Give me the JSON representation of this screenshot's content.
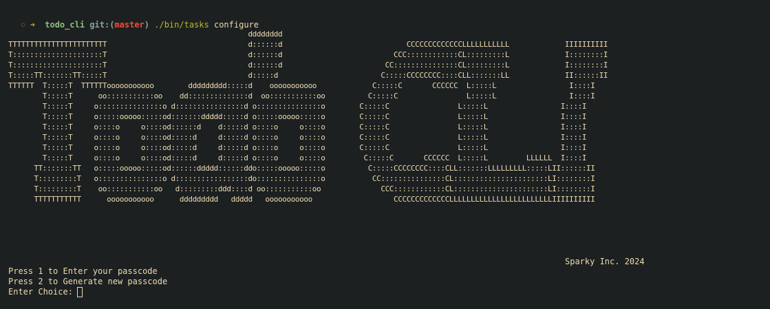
{
  "prompt": {
    "indicator": "○",
    "arrow": "➜",
    "directory": "todo_cli",
    "git_label": "git:",
    "paren_open": "(",
    "branch": "master",
    "paren_close": ")",
    "command_path": "./bin/tasks",
    "command_arg": "configure"
  },
  "banner": {
    "art_lines": [
      "                                                        dddddddd",
      "TTTTTTTTTTTTTTTTTTTTTTT                                 d::::::d                             CCCCCCCCCCCCCLLLLLLLLLLL             IIIIIIIIII",
      "T:::::::::::::::::::::T                                 d::::::d                          CCC::::::::::::CL:::::::::L             I::::::::I",
      "T:::::::::::::::::::::T                                 d::::::d                        CC:::::::::::::::CL:::::::::L             I::::::::I",
      "T:::::TT:::::::TT:::::T                                 d:::::d                        C:::::CCCCCCCC::::CLL:::::::LL             II::::::II",
      "TTTTTT  T:::::T  TTTTTTooooooooooo        ddddddddd:::::d    ooooooooooo             C:::::C       CCCCCC  L:::::L                 I::::I",
      "        T:::::T      oo:::::::::::oo    dd::::::::::::::d  oo:::::::::::oo          C:::::C                L:::::L                 I::::I",
      "        T:::::T     o:::::::::::::::o d::::::::::::::::d o:::::::::::::::o        C:::::C                L:::::L                 I::::I",
      "        T:::::T     o:::::ooooo:::::od:::::::ddddd:::::d o:::::ooooo:::::o        C:::::C                L:::::L                 I::::I",
      "        T:::::T     o::::o     o::::od::::::d    d:::::d o::::o     o::::o        C:::::C                L:::::L                 I::::I",
      "        T:::::T     o::::o     o::::od:::::d     d:::::d o::::o     o::::o        C:::::C                L:::::L                 I::::I",
      "        T:::::T     o::::o     o::::od:::::d     d:::::d o::::o     o::::o        C:::::C                L:::::L                 I::::I",
      "        T:::::T     o::::o     o::::od:::::d     d:::::d o::::o     o::::o         C:::::C       CCCCCC  L:::::L         LLLLLL  I::::I",
      "      TT:::::::TT   o:::::ooooo:::::od::::::ddddd::::::ddo:::::ooooo:::::o          C:::::CCCCCCCC::::CLL:::::::LLLLLLLLL:::::LII::::::II",
      "      T:::::::::T   o:::::::::::::::o d:::::::::::::::::do:::::::::::::::o           CC:::::::::::::::CL::::::::::::::::::::::LI::::::::I",
      "      T:::::::::T    oo:::::::::::oo   d:::::::::ddd::::d oo:::::::::::oo              CCC::::::::::::CL::::::::::::::::::::::LI::::::::I",
      "      TTTTTTTTTTT      ooooooooooo      ddddddddd   ddddd   ooooooooooo                   CCCCCCCCCCCCCLLLLLLLLLLLLLLLLLLLLLLLLIIIIIIIIII"
    ]
  },
  "tagline": "Sparky Inc. 2024",
  "menu": {
    "option_1": "Press 1 to Enter your passcode",
    "option_2": "Press 2 to Generate new passcode",
    "choice_prompt": "Enter Choice:"
  },
  "colors": {
    "background": "#1d2021",
    "foreground": "#ebdbb2",
    "arrow": "#b8bb26",
    "directory": "#8ec07c",
    "git": "#83a598",
    "branch": "#fb4934"
  }
}
